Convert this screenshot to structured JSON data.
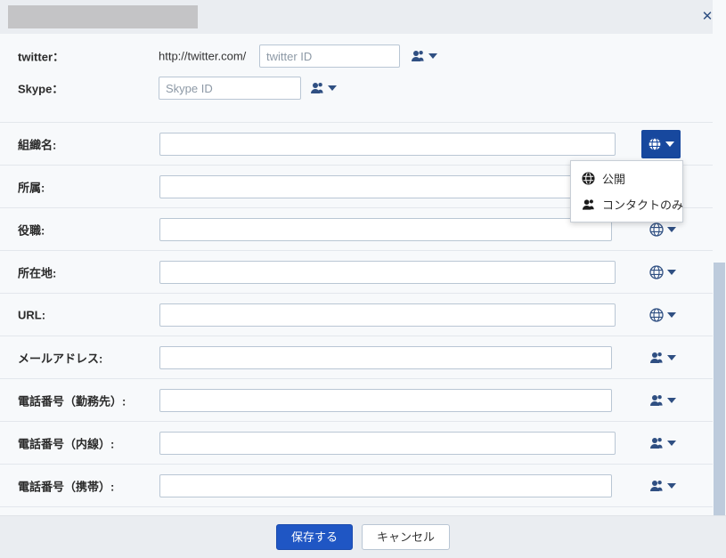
{
  "window": {
    "close_label": "✕",
    "redacted_title": ""
  },
  "clipped_row": {
    "label": "",
    "middle": "",
    "link": ""
  },
  "colors": {
    "accent_blue": "#1f56c4",
    "icon_blue": "#2f4f82",
    "active_dropdown_blue": "#17489e",
    "page_background": "#f7f9fb",
    "chrome_background": "#eaedf1",
    "input_border": "#b9c6d4",
    "scrollbar_thumb": "#bdcbdc"
  },
  "social_rows": [
    {
      "label": "twitter：",
      "prefix": "http://twitter.com/",
      "placeholder": "twitter ID",
      "value": "",
      "privacy_icon": "contacts-icon"
    },
    {
      "label": "Skype：",
      "prefix": "",
      "placeholder": "Skype ID",
      "value": "",
      "privacy_icon": "contacts-icon"
    }
  ],
  "form_rows": [
    {
      "label": "組織名:",
      "placeholder": "",
      "value": "",
      "privacy_icon": "globe-icon",
      "menu_open": true
    },
    {
      "label": "所属:",
      "placeholder": "",
      "value": "",
      "privacy_icon": "globe-icon",
      "menu_open": false
    },
    {
      "label": "役職:",
      "placeholder": "",
      "value": "",
      "privacy_icon": "globe-icon",
      "menu_open": false
    },
    {
      "label": "所在地:",
      "placeholder": "",
      "value": "",
      "privacy_icon": "globe-icon",
      "menu_open": false
    },
    {
      "label": "URL:",
      "placeholder": "",
      "value": "",
      "privacy_icon": "globe-icon",
      "menu_open": false
    },
    {
      "label": "メールアドレス:",
      "placeholder": "",
      "value": "",
      "privacy_icon": "contacts-icon",
      "menu_open": false
    },
    {
      "label": "電話番号（勤務先）:",
      "placeholder": "",
      "value": "",
      "privacy_icon": "contacts-icon",
      "menu_open": false
    },
    {
      "label": "電話番号（内線）:",
      "placeholder": "",
      "value": "",
      "privacy_icon": "contacts-icon",
      "menu_open": false
    },
    {
      "label": "電話番号（携帯）:",
      "placeholder": "",
      "value": "",
      "privacy_icon": "contacts-icon",
      "menu_open": false
    }
  ],
  "privacy_menu": {
    "items": [
      {
        "label": "公開",
        "icon": "globe-icon"
      },
      {
        "label": "コンタクトのみ",
        "icon": "contacts-icon"
      }
    ]
  },
  "footer": {
    "save_label": "保存する",
    "cancel_label": "キャンセル"
  }
}
